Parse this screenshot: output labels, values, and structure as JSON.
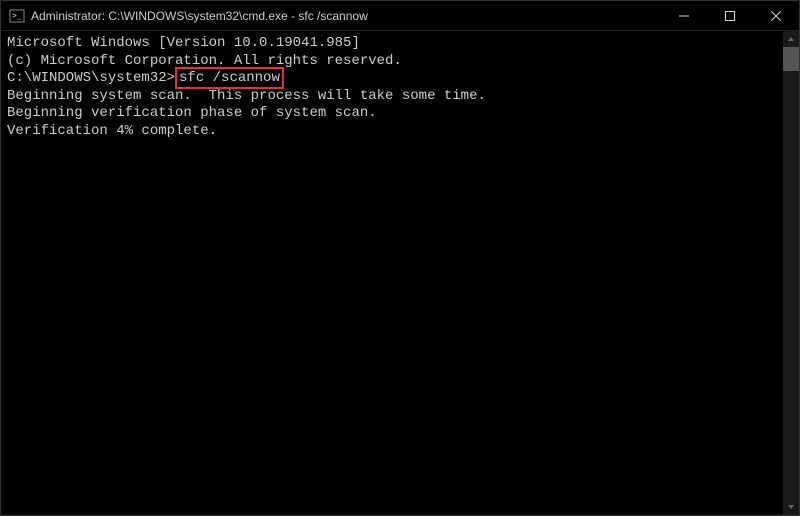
{
  "titlebar": {
    "title": "Administrator: C:\\WINDOWS\\system32\\cmd.exe - sfc  /scannow"
  },
  "terminal": {
    "line1": "Microsoft Windows [Version 10.0.19041.985]",
    "line2": "(c) Microsoft Corporation. All rights reserved.",
    "blank1": "",
    "prompt": "C:\\WINDOWS\\system32>",
    "command": "sfc /scannow",
    "blank2": "",
    "line3": "Beginning system scan.  This process will take some time.",
    "blank3": "",
    "line4": "Beginning verification phase of system scan.",
    "line5": "Verification 4% complete."
  }
}
